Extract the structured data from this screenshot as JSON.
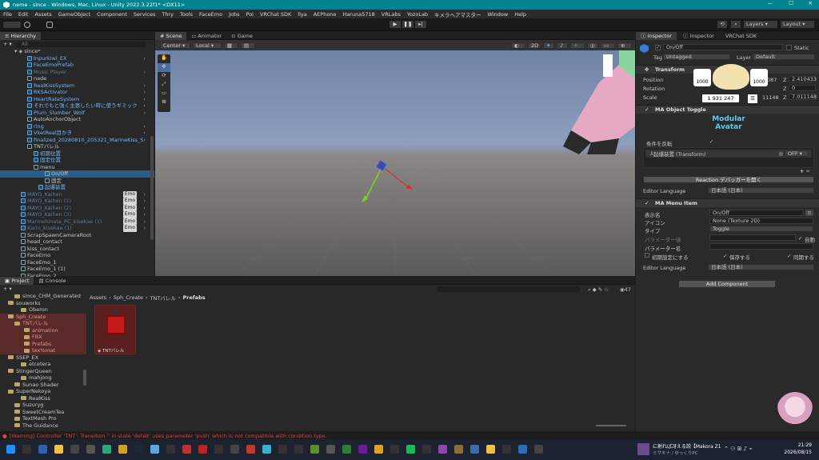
{
  "window": {
    "title": "neme - since - Windows, Mac, Linux - Unity 2022.3.22f1* <DX11>"
  },
  "menu": [
    "File",
    "Edit",
    "Assets",
    "GameObject",
    "Component",
    "Services",
    "Thry",
    "Tools",
    "FaceEmo",
    "Jobs",
    "Poi",
    "VRChat SDK",
    "llya",
    "AEPhone",
    "Haruna5718",
    "VRLabs",
    "YozoLab",
    "キメラヘアマスター",
    "Window",
    "Help"
  ],
  "toolbar": {
    "layers": "Layers",
    "layout": "Layout"
  },
  "hierarchy": {
    "tab": "Hierarchy",
    "search_placeholder": "All",
    "scene": "since*",
    "items": [
      {
        "t": "Inpurkiwi_EX",
        "indent": 34,
        "style": "blue",
        "cube": "blue",
        "arrow": "›"
      },
      {
        "t": "FaceEmoPrefab",
        "indent": 34,
        "style": "blue",
        "cube": "blue",
        "arrow": ""
      },
      {
        "t": "Music Player",
        "indent": 34,
        "style": "dim",
        "cube": "blue",
        "arrow": "›"
      },
      {
        "t": "nade",
        "indent": 34,
        "style": "",
        "cube": "",
        "arrow": ""
      },
      {
        "t": "RealKissSystem",
        "indent": 34,
        "style": "blue",
        "cube": "blue",
        "arrow": "›"
      },
      {
        "t": "RKSActivator",
        "indent": 34,
        "style": "blue",
        "cube": "blue",
        "arrow": "›"
      },
      {
        "t": "HeartRateSystem",
        "indent": 34,
        "style": "blue",
        "cube": "blue",
        "arrow": "›"
      },
      {
        "t": "それでもと強く主張したい時に使うギミック",
        "indent": 34,
        "style": "blue",
        "cube": "blue",
        "arrow": "›"
      },
      {
        "t": "Plum_Slumber_Wolf",
        "indent": 34,
        "style": "blue",
        "cube": "blue",
        "arrow": "›"
      },
      {
        "t": "AutoAnchorObject",
        "indent": 34,
        "style": "",
        "cube": "",
        "arrow": ""
      },
      {
        "t": "ring",
        "indent": 34,
        "style": "blue",
        "cube": "blue",
        "arrow": "›"
      },
      {
        "t": "VketReal目かき",
        "indent": 34,
        "style": "blue",
        "cube": "blue",
        "arrow": "›"
      },
      {
        "t": "finalized_20280810_205321_MarineKiss_S",
        "indent": 34,
        "style": "blue",
        "cube": "blue",
        "arrow": "›"
      },
      {
        "t": "TNTバレル",
        "indent": 34,
        "style": "",
        "cube": "",
        "arrow": ""
      },
      {
        "t": "初期位置",
        "indent": 42,
        "style": "blue",
        "cube": "blue",
        "arrow": ""
      },
      {
        "t": "固定位置",
        "indent": 42,
        "style": "blue",
        "cube": "blue",
        "arrow": ""
      },
      {
        "t": "menu",
        "indent": 42,
        "style": "",
        "cube": "",
        "arrow": ""
      },
      {
        "t": "On/Off",
        "indent": 56,
        "style": "sel",
        "cube": "",
        "arrow": ""
      },
      {
        "t": "固定",
        "indent": 56,
        "style": "",
        "cube": "",
        "arrow": ""
      },
      {
        "t": "起爆装置",
        "indent": 48,
        "style": "blue",
        "cube": "blue",
        "arrow": ""
      },
      {
        "t": "MAYO_Kaihen",
        "indent": 26,
        "style": "dim",
        "cube": "blue",
        "arrow": "›",
        "badge": "Emo"
      },
      {
        "t": "MAYO_Kaihen (1)",
        "indent": 26,
        "style": "dim",
        "cube": "blue",
        "arrow": "›",
        "badge": "Emo"
      },
      {
        "t": "MAYO_Kaihen (2)",
        "indent": 26,
        "style": "dim",
        "cube": "blue",
        "arrow": "›",
        "badge": "Emo"
      },
      {
        "t": "MAYO_Kaihen (3)",
        "indent": 26,
        "style": "dim",
        "cube": "blue",
        "arrow": "›",
        "badge": "Emo"
      },
      {
        "t": "Marinehinata_PC_kisekae (1)",
        "indent": 26,
        "style": "dim",
        "cube": "blue",
        "arrow": "›",
        "badge": "Emo"
      },
      {
        "t": "Karin_kisekae (1)",
        "indent": 26,
        "style": "dim",
        "cube": "blue",
        "arrow": "›",
        "badge": "Emo"
      },
      {
        "t": "ScrapSpawnCameraRoot",
        "indent": 26,
        "style": "",
        "cube": "",
        "arrow": ""
      },
      {
        "t": "head_contact",
        "indent": 26,
        "style": "",
        "cube": "",
        "arrow": ""
      },
      {
        "t": "kiss_contact",
        "indent": 26,
        "style": "",
        "cube": "",
        "arrow": ""
      },
      {
        "t": "FaceEmo",
        "indent": 26,
        "style": "",
        "cube": "",
        "arrow": ""
      },
      {
        "t": "FaceEmo_1",
        "indent": 26,
        "style": "",
        "cube": "",
        "arrow": ""
      },
      {
        "t": "FaceEmo_1 (1)",
        "indent": 26,
        "style": "",
        "cube": "",
        "arrow": ""
      },
      {
        "t": "FaceEmo_2",
        "indent": 26,
        "style": "",
        "cube": "",
        "arrow": ""
      }
    ]
  },
  "scene": {
    "tabs": [
      "Scene",
      "Animator",
      "Game"
    ],
    "pivot": "Center",
    "space": "Local",
    "mode_2d": "2D"
  },
  "project": {
    "tabs": [
      "Project",
      "Console"
    ],
    "breadcrumb": [
      "Assets",
      "Sph_Create",
      "TNTバレル",
      "Prefabs"
    ],
    "asset": {
      "name": "TNTバレル"
    },
    "count": "47",
    "tree": [
      {
        "t": "since_CHM_Generated",
        "indent": 18,
        "hl": false
      },
      {
        "t": "souworks",
        "indent": 10,
        "hl": false
      },
      {
        "t": "Oberon",
        "indent": 26,
        "hl": false
      },
      {
        "t": "Sph_Create",
        "indent": 10,
        "hl": true
      },
      {
        "t": "TNTバレル",
        "indent": 18,
        "hl": true
      },
      {
        "t": "animation",
        "indent": 30,
        "hl": true
      },
      {
        "t": "FBX",
        "indent": 30,
        "hl": true
      },
      {
        "t": "Prefabs",
        "indent": 30,
        "hl": true
      },
      {
        "t": "tex%mat",
        "indent": 30,
        "hl": true
      },
      {
        "t": "SSEP_EX",
        "indent": 10,
        "hl": false
      },
      {
        "t": "etcetera",
        "indent": 26,
        "hl": false
      },
      {
        "t": "StingerQueen",
        "indent": 10,
        "hl": false
      },
      {
        "t": "mahjong",
        "indent": 26,
        "hl": false
      },
      {
        "t": "Sunao Shader",
        "indent": 18,
        "hl": false
      },
      {
        "t": "SuperNekoya",
        "indent": 10,
        "hl": false
      },
      {
        "t": "RealKiss",
        "indent": 26,
        "hl": false
      },
      {
        "t": "Suzuryg",
        "indent": 18,
        "hl": false
      },
      {
        "t": "SweetCreamTea",
        "indent": 18,
        "hl": false
      },
      {
        "t": "TextMesh Pro",
        "indent": 18,
        "hl": false
      },
      {
        "t": "The Guidance",
        "indent": 18,
        "hl": false
      }
    ]
  },
  "status": {
    "warning": "[Warning] Controller 'TNT': Transition '' in state 'defalt' uses parameter 'push' which is not compatible with condition type."
  },
  "inspector": {
    "tabs": [
      "Inspector",
      "Inspector",
      "VRChat SDK"
    ],
    "object_name": "On/Off",
    "static_label": "Static",
    "tag_label": "Tag",
    "tag_value": "Untagged",
    "layer_label": "Layer",
    "layer_value": "Default",
    "transform": {
      "title": "Transform",
      "position_label": "Position",
      "rotation_label": "Rotation",
      "scale_label": "Scale",
      "pos_partial": "087",
      "pos_z": "2.410433",
      "rot_z": "0",
      "scale_partial": "11148",
      "scale_z": "7.011148"
    },
    "overlay": {
      "badge1": "1000",
      "badge2": "1000",
      "count": "1 931 247"
    },
    "ma_toggle": {
      "title": "MA Object Toggle",
      "brand_line1": "Modular",
      "brand_line2": "Avatar",
      "invert_label": "条件を反転",
      "item": "起爆装置 (Transform)",
      "state": "OFF",
      "reaction_button": "Reaction デバッガーを開く",
      "lang_label": "Editor Language",
      "lang_value": "日本語 (日本)"
    },
    "ma_menu": {
      "title": "MA Menu Item",
      "name_label": "表示名",
      "name_value": "On/Off",
      "icon_label": "アイコン",
      "icon_value": "None (Texture 2D)",
      "type_label": "タイプ",
      "type_value": "Toggle",
      "param_label": "パラメーター値",
      "auto_label": "自動",
      "param_name_label": "パラメーター名",
      "default_label": "初期設定にする",
      "saved_label": "保存する",
      "sync_label": "同期する",
      "lang_label": "Editor Language",
      "lang_value": "日本語 (日本)"
    },
    "add_component": "Add Component"
  },
  "taskbar": {
    "music_title": "に射れば冴える説【Makora Z1",
    "music_artist": "ミサキナ / ゆっくりPC",
    "time": "21:29",
    "date": "2026/08/15"
  }
}
